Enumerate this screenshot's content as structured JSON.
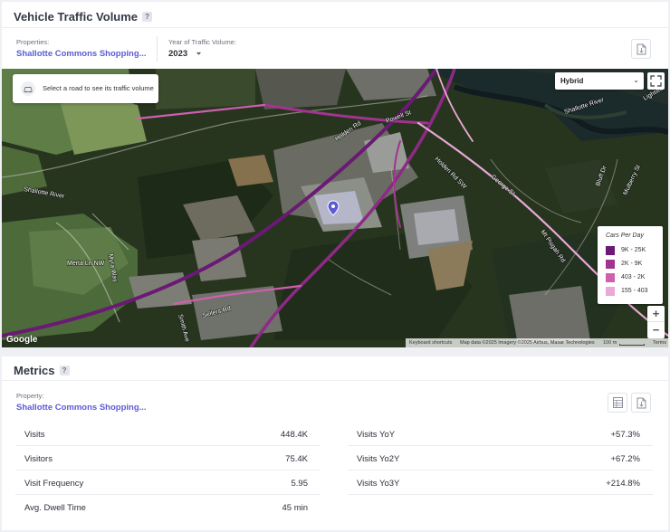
{
  "traffic": {
    "title": "Vehicle Traffic Volume",
    "help": "?",
    "properties_label": "Properties:",
    "property_name": "Shallotte Commons Shopping...",
    "year_label": "Year of Traffic Volume:",
    "year_value": "2023",
    "year_chevron": "⌄"
  },
  "map": {
    "hint_text": "Select a road to see its traffic volume",
    "map_type": "Hybrid",
    "map_type_chevron": "⌄",
    "labels": {
      "powell_st": "Powell St",
      "holden_rd": "Holden Rd",
      "shallotte_river_left": "Shallotte River",
      "shallotte_river_right": "Shallotte River",
      "merta_ln": "Merta Ln NW",
      "myra_wayw": "Myra Way",
      "gerge_st": "George St",
      "sellers_rd": "Sellers Rd",
      "smith_ave": "Smith Ave",
      "bluff_dr": "Bluff Dr",
      "mulberry_st": "Mulberry St",
      "lightwood": "Lightwo",
      "holden_rd_sw": "Holden Rd SW",
      "st_ln": "Mt Pisgah Rd"
    },
    "legend": {
      "title": "Cars Per Day",
      "items": [
        {
          "label": "9K - 25K",
          "color": "#6a1a74"
        },
        {
          "label": "2K - 9K",
          "color": "#a1348f"
        },
        {
          "label": "403 - 2K",
          "color": "#cf5fb0"
        },
        {
          "label": "155 - 403",
          "color": "#e8a9d6"
        }
      ]
    },
    "zoom_in": "+",
    "zoom_out": "−",
    "google_logo": "Google",
    "attribution": {
      "shortcuts": "Keyboard shortcuts",
      "data": "Map data ©2025 Imagery ©2025 Airbus, Maxar Technologies",
      "scale": "100 m",
      "terms": "Terms"
    },
    "road_color": "#b2379b",
    "pin_color": "#5b5bd6"
  },
  "metrics": {
    "title": "Metrics",
    "help": "?",
    "property_label": "Property:",
    "property_name": "Shallotte Commons Shopping...",
    "left": [
      {
        "label": "Visits",
        "value": "448.4K"
      },
      {
        "label": "Visitors",
        "value": "75.4K"
      },
      {
        "label": "Visit Frequency",
        "value": "5.95"
      },
      {
        "label": "Avg. Dwell Time",
        "value": "45 min"
      }
    ],
    "right": [
      {
        "label": "Visits YoY",
        "value": "+57.3%"
      },
      {
        "label": "Visits Yo2Y",
        "value": "+67.2%"
      },
      {
        "label": "Visits Yo3Y",
        "value": "+214.8%"
      }
    ]
  }
}
